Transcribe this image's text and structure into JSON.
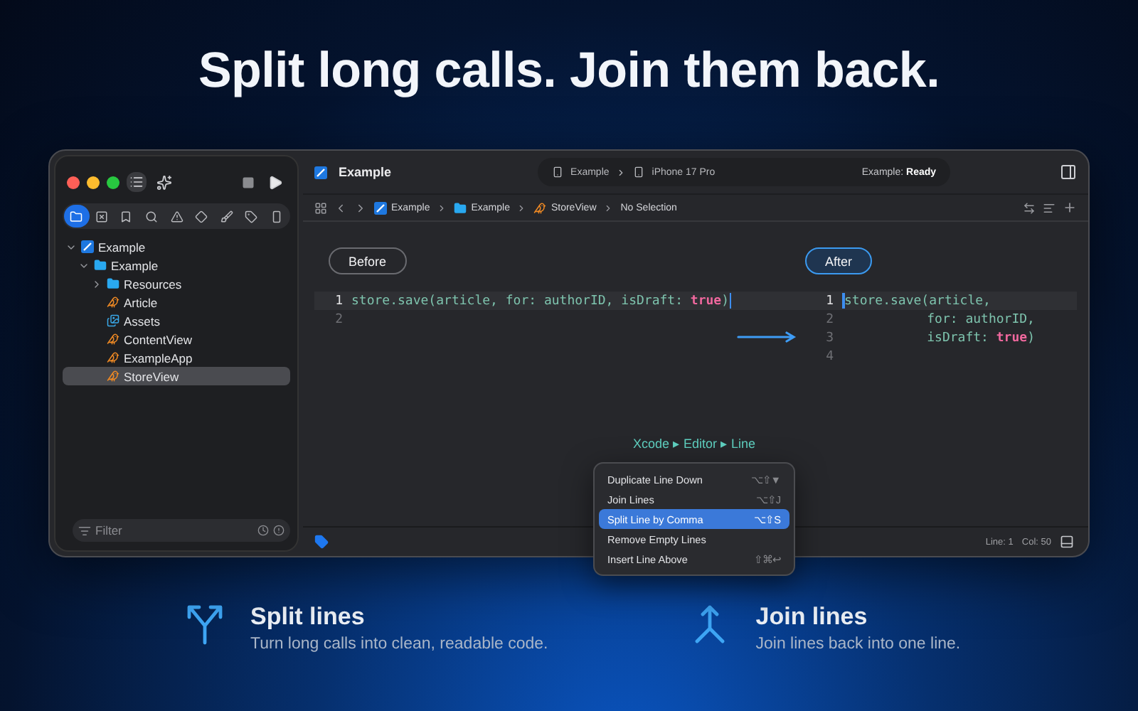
{
  "headline": "Split long calls. Join them back.",
  "window": {
    "title": "Example",
    "scheme": {
      "project": "Example",
      "device": "iPhone 17 Pro"
    },
    "status": "Example: **Ready**"
  },
  "navigator_tabs": [
    {
      "selected": true
    },
    {
      "selected": false
    },
    {
      "selected": false
    },
    {
      "selected": false
    },
    {
      "selected": false
    },
    {
      "selected": false
    },
    {
      "selected": false
    },
    {
      "selected": false
    },
    {
      "selected": false
    }
  ],
  "tree": [
    {
      "label": "Example",
      "kind": "project",
      "expanded": true,
      "selected": false,
      "children": [
        {
          "label": "Example",
          "kind": "folder",
          "expanded": true,
          "selected": false,
          "children": [
            {
              "label": "Resources",
              "kind": "folder",
              "expanded": false,
              "selected": false
            },
            {
              "label": "Article",
              "kind": "swift",
              "selected": false
            },
            {
              "label": "Assets",
              "kind": "assets",
              "selected": false
            },
            {
              "label": "ContentView",
              "kind": "swift",
              "selected": false
            },
            {
              "label": "ExampleApp",
              "kind": "swift",
              "selected": false
            },
            {
              "label": "StoreView",
              "kind": "swift",
              "selected": true
            }
          ]
        }
      ]
    }
  ],
  "filter": {
    "placeholder": "Filter"
  },
  "breadcrumb": [
    {
      "label": "Example",
      "kind": "project"
    },
    {
      "label": "Example",
      "kind": "folder"
    },
    {
      "label": "StoreView",
      "kind": "swift"
    },
    {
      "label": "No Selection",
      "kind": "none"
    }
  ],
  "panes": [
    {
      "label": "Before",
      "selected": false,
      "lines": [
        {
          "number": "1",
          "current": true,
          "segments": [
            {
              "text": "store.save(article, for: authorID, isDraft: ",
              "kind": "plain"
            },
            {
              "text": "true",
              "kind": "keyword"
            },
            {
              "text": ")",
              "kind": "plain"
            },
            {
              "kind": "caret"
            }
          ]
        },
        {
          "number": "2",
          "current": false
        }
      ]
    },
    {
      "label": "After",
      "selected": true,
      "lines": [
        {
          "number": "1",
          "current": true,
          "segments": [
            {
              "kind": "caret"
            },
            {
              "text": "store.save(article,",
              "kind": "plain"
            }
          ]
        },
        {
          "number": "2",
          "current": false,
          "segments": [
            {
              "text": "           for: authorID,",
              "kind": "plain"
            }
          ]
        },
        {
          "number": "3",
          "current": false,
          "segments": [
            {
              "text": "           isDraft: ",
              "kind": "plain"
            },
            {
              "text": "true",
              "kind": "keyword"
            },
            {
              "text": ")",
              "kind": "plain"
            }
          ]
        },
        {
          "number": "4",
          "current": false
        }
      ]
    }
  ],
  "menu_path": "Xcode ▸ Editor ▸ Line",
  "menu": [
    {
      "label": "Duplicate Line Down",
      "shortcut": "⌥⇧▼",
      "selected": false
    },
    {
      "label": "Join Lines",
      "shortcut": "⌥⇧J",
      "selected": false
    },
    {
      "label": "Split Line by Comma",
      "shortcut": "⌥⇧S",
      "selected": true
    },
    {
      "label": "Remove Empty Lines",
      "selected": false
    },
    {
      "label": "Insert Line Above",
      "shortcut": "⇧⌘↩",
      "selected": false
    }
  ],
  "status_bar": {
    "line": "Line: 1",
    "column": "Col: 50"
  },
  "features": [
    {
      "kind": "split",
      "title": "Split lines",
      "description": "Turn long calls into clean, readable code."
    },
    {
      "kind": "join",
      "title": "Join lines",
      "description": "Join lines back into one line."
    }
  ]
}
